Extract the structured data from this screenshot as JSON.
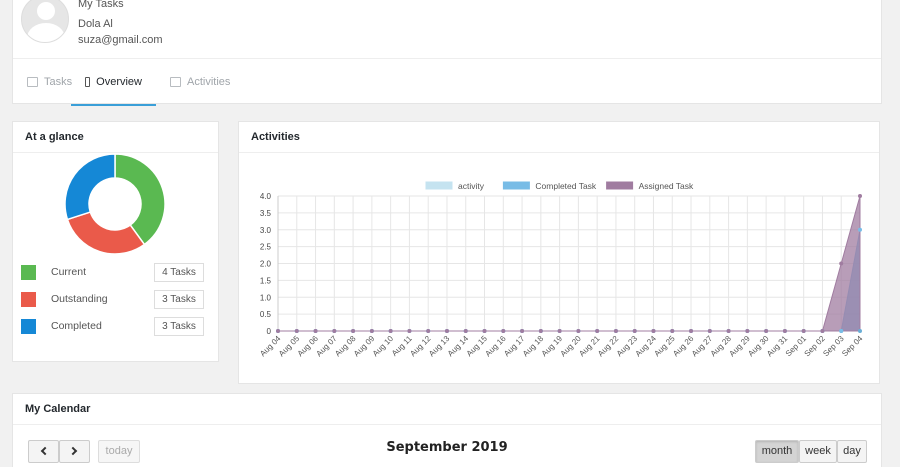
{
  "profile": {
    "title": "My Tasks",
    "name": "Dola Al",
    "email": "suza@gmail.com"
  },
  "tabs": [
    {
      "label": "Tasks",
      "icon": "monitor-icon",
      "active": false
    },
    {
      "label": "Overview",
      "icon": "image-icon",
      "active": true
    },
    {
      "label": "Activities",
      "icon": "calendar-icon",
      "active": false
    }
  ],
  "glance": {
    "title": "At a glance",
    "items": [
      {
        "label": "Current",
        "count": "4 Tasks",
        "color": "#5ab951",
        "value": 4
      },
      {
        "label": "Outstanding",
        "count": "3 Tasks",
        "color": "#ea5a4a",
        "value": 3
      },
      {
        "label": "Completed",
        "count": "3 Tasks",
        "color": "#1588d6",
        "value": 3
      }
    ]
  },
  "activities": {
    "title": "Activities"
  },
  "chart_data": {
    "type": "area",
    "categories": [
      "Aug 04",
      "Aug 05",
      "Aug 06",
      "Aug 07",
      "Aug 08",
      "Aug 09",
      "Aug 10",
      "Aug 11",
      "Aug 12",
      "Aug 13",
      "Aug 14",
      "Aug 15",
      "Aug 16",
      "Aug 17",
      "Aug 18",
      "Aug 19",
      "Aug 20",
      "Aug 21",
      "Aug 22",
      "Aug 23",
      "Aug 24",
      "Aug 25",
      "Aug 26",
      "Aug 27",
      "Aug 28",
      "Aug 29",
      "Aug 30",
      "Aug 31",
      "Sep 01",
      "Sep 02",
      "Sep 03",
      "Sep 04"
    ],
    "yticks": [
      "4.0",
      "3.5",
      "3.0",
      "2.5",
      "2.0",
      "1.5",
      "1.0",
      "0.5",
      "0"
    ],
    "ylim": [
      0,
      4
    ],
    "grid": true,
    "legend": "top-center",
    "series": [
      {
        "name": "activity",
        "color": "#c5e3f0",
        "values": [
          0,
          0,
          0,
          0,
          0,
          0,
          0,
          0,
          0,
          0,
          0,
          0,
          0,
          0,
          0,
          0,
          0,
          0,
          0,
          0,
          0,
          0,
          0,
          0,
          0,
          0,
          0,
          0,
          0,
          0,
          0,
          0
        ]
      },
      {
        "name": "Completed Task",
        "color": "#78bce6",
        "values": [
          0,
          0,
          0,
          0,
          0,
          0,
          0,
          0,
          0,
          0,
          0,
          0,
          0,
          0,
          0,
          0,
          0,
          0,
          0,
          0,
          0,
          0,
          0,
          0,
          0,
          0,
          0,
          0,
          0,
          0,
          0,
          3
        ]
      },
      {
        "name": "Assigned Task",
        "color": "#a07ca0",
        "values": [
          0,
          0,
          0,
          0,
          0,
          0,
          0,
          0,
          0,
          0,
          0,
          0,
          0,
          0,
          0,
          0,
          0,
          0,
          0,
          0,
          0,
          0,
          0,
          0,
          0,
          0,
          0,
          0,
          0,
          0,
          2,
          4
        ]
      }
    ]
  },
  "calendar": {
    "title": "My Calendar",
    "month_title": "September 2019",
    "today_label": "today",
    "views": [
      "month",
      "week",
      "day"
    ],
    "active_view": "month"
  }
}
